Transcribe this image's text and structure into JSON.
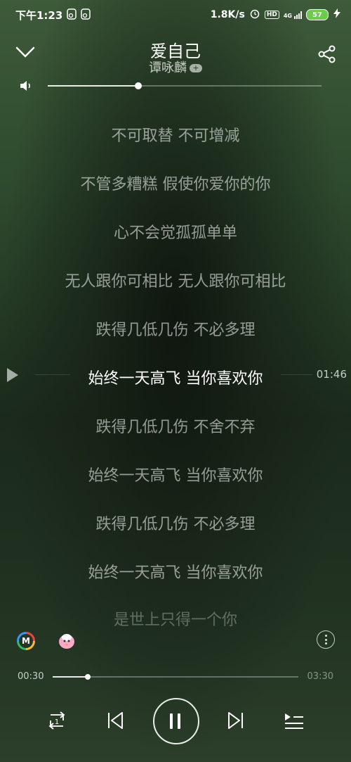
{
  "status_bar": {
    "time": "下午1:23",
    "net_speed": "1.8K/s",
    "hd": "HD",
    "signal": "4G",
    "battery": "57"
  },
  "song": {
    "title": "爱自己",
    "artist": "谭咏麟",
    "artist_badge": "+"
  },
  "volume": {
    "level": 0.33
  },
  "lyrics": [
    "不可取替  不可增减",
    "不管多糟糕 假使你爱你的你",
    "心不会觉孤孤单单",
    "无人跟你可相比 无人跟你可相比",
    "跌得几低几伤 不必多理",
    "始终一天高飞  当你喜欢你",
    "跌得几低几伤 不舍不弃",
    "始终一天高飞 当你喜欢你",
    "跌得几低几伤 不必多理",
    "始终一天高飞  当你喜欢你",
    "是世上只得一个你"
  ],
  "current_line_index": 5,
  "current_line_time": "01:46",
  "progress": {
    "elapsed": "00:30",
    "total": "03:30",
    "fraction": 0.143
  },
  "controls": {
    "repeat_badge": "1"
  },
  "icons": {
    "back": "chevron-down-icon",
    "share": "share-icon",
    "volume": "speaker-icon",
    "miui": "m-app-icon",
    "bird": "bird-icon",
    "more": "more-icon"
  }
}
